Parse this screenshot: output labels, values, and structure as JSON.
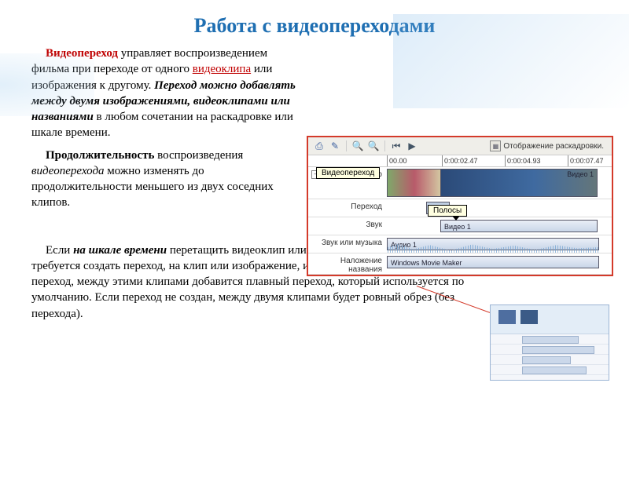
{
  "title": "Работа с видеопереходами",
  "p1": {
    "lead": "Видеопереход",
    "a": " управляет воспроизведением фильма при переходе от одного ",
    "link": "видеоклипа",
    "b": " или изображения к другому. ",
    "bold": "Переход можно добавлять между двумя изображениями, видеоклипами или названиями",
    "c": " в любом сочетании на раскадровке или шкале времени."
  },
  "p2": {
    "lead": "Продолжительность",
    "a": " воспроизведения ",
    "i": "видеоперехода",
    "b": " можно изменять до продолжительности меньшего из двух соседних клипов."
  },
  "p3": {
    "a": "Если ",
    "bi": "на шкале времени",
    "b": " перетащить видеоклип или изображение, к которым требуется создать переход, на клип или изображение, из которых требуется создать переход, между этими клипами добавится плавный переход, который используется по умолчанию. Если переход не создан, между двумя клипами будет ровный обрез (без перехода)."
  },
  "editor": {
    "storyboard_label": "Отображение раскадровки.",
    "ruler": {
      "t1": "00.00",
      "t2": "0:00:02.47",
      "t3": "0:00:04.93",
      "t4": "0:00:07.47"
    },
    "callouts": {
      "transition": "Видеопереход",
      "stripes": "Полосы"
    },
    "tracks": {
      "video": "Видео",
      "transition": "Переход",
      "sound": "Звук",
      "music": "Звук или музыка",
      "overlay": "Наложение названия"
    },
    "clips": {
      "video1_cap": "Видео 1",
      "sound_clip": "Видео 1",
      "audio_clip": "Аудио 1",
      "overlay_clip": "Windows Movie Maker"
    }
  }
}
